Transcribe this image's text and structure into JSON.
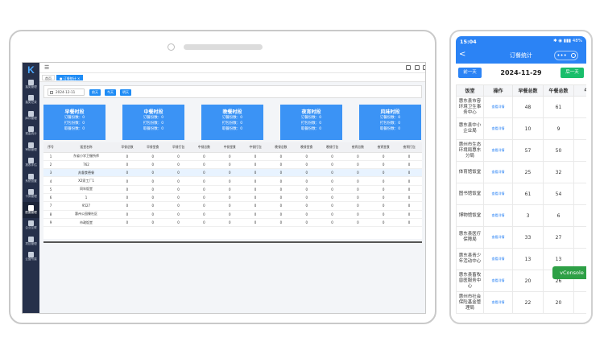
{
  "desktop": {
    "sidebar": {
      "logo": "K",
      "items": [
        {
          "label": "抽奖管理",
          "active": false
        },
        {
          "label": "抽奖记录",
          "active": false
        },
        {
          "label": "库存管理",
          "active": false
        },
        {
          "label": "现金统计",
          "active": false
        },
        {
          "label": "审核管理",
          "active": false
        },
        {
          "label": "报表评估",
          "active": false
        },
        {
          "label": "系统设置",
          "active": false
        },
        {
          "label": "卡券管理",
          "active": false
        },
        {
          "label": "配置管理",
          "active": true
        },
        {
          "label": "企业互联",
          "active": false
        },
        {
          "label": "项目管理",
          "active": false
        },
        {
          "label": "云盘所属",
          "active": false
        }
      ]
    },
    "topbar": {
      "fold_icon": "menu-fold-icon"
    },
    "tags": [
      {
        "label": "首页",
        "active": false
      },
      {
        "label": "● 订餐统计 ×",
        "active": true
      }
    ],
    "filter": {
      "date_value": "2024-12-11",
      "buttons": [
        "前天",
        "今天",
        "明天"
      ]
    },
    "cards": [
      {
        "title": "早餐时段",
        "lines": [
          "订餐份数：0",
          "打包份数：0",
          "取餐份数：0"
        ]
      },
      {
        "title": "中餐时段",
        "lines": [
          "订餐份数：0",
          "打包份数：0",
          "取餐份数：0"
        ]
      },
      {
        "title": "晚餐时段",
        "lines": [
          "订餐份数：0",
          "打包份数：0",
          "取餐份数：0"
        ]
      },
      {
        "title": "夜宵时段",
        "lines": [
          "订餐份数：0",
          "打包份数：0",
          "取餐份数：0"
        ]
      },
      {
        "title": "风味时段",
        "lines": [
          "订餐份数：0",
          "打包份数：0",
          "取餐份数：0"
        ]
      }
    ],
    "table": {
      "headers": [
        "序号",
        "饭堂名称",
        "早餐总数",
        "早餐堂食",
        "早餐打包",
        "中餐总数",
        "中餐堂食",
        "中餐打包",
        "晚餐总数",
        "晚餐堂食",
        "晚餐打包",
        "夜宵总数",
        "夜宵堂食",
        "夜宵打包"
      ],
      "rows": [
        [
          "1",
          "东省小学卫服所师",
          "0",
          "0",
          "0",
          "0",
          "0",
          "0",
          "0",
          "0",
          "0",
          "0",
          "0",
          "0"
        ],
        [
          "2",
          "762",
          "0",
          "0",
          "0",
          "0",
          "0",
          "0",
          "0",
          "0",
          "0",
          "0",
          "0",
          "0"
        ],
        [
          "3",
          "苏督食德餐",
          "0",
          "0",
          "0",
          "0",
          "0",
          "0",
          "0",
          "0",
          "0",
          "0",
          "0",
          "0"
        ],
        [
          "4",
          "X2家工厂1",
          "0",
          "0",
          "0",
          "0",
          "0",
          "0",
          "0",
          "0",
          "0",
          "0",
          "0",
          "0"
        ],
        [
          "5",
          "同年饭堂",
          "0",
          "0",
          "0",
          "0",
          "0",
          "0",
          "0",
          "0",
          "0",
          "0",
          "0",
          "0"
        ],
        [
          "6",
          "1",
          "0",
          "0",
          "0",
          "0",
          "0",
          "0",
          "0",
          "0",
          "0",
          "0",
          "0",
          "0"
        ],
        [
          "7",
          "9527",
          "0",
          "0",
          "0",
          "0",
          "0",
          "0",
          "0",
          "0",
          "0",
          "0",
          "0",
          "0"
        ],
        [
          "8",
          "惠州公园餐社区",
          "0",
          "0",
          "0",
          "0",
          "0",
          "0",
          "0",
          "0",
          "0",
          "0",
          "0",
          "0"
        ],
        [
          "9",
          "市政饭堂",
          "0",
          "0",
          "0",
          "0",
          "0",
          "0",
          "0",
          "0",
          "0",
          "0",
          "0",
          "0"
        ]
      ]
    }
  },
  "phone": {
    "status": {
      "time": "15:04",
      "icons": "✱ ◉ ▮▮▮ 48%"
    },
    "nav": {
      "title": "订餐统计",
      "back": "<",
      "dots": "•••"
    },
    "date": "2024-11-29",
    "prev_label": "前一天",
    "next_label": "后一天",
    "headers": [
      "饭堂",
      "操作",
      "早餐总数",
      "午餐总数",
      "午餐"
    ],
    "op_label": "查看详情",
    "rows": [
      {
        "name": "惠东县市容环境卫生事务中心",
        "vals": [
          "48",
          "61",
          "6"
        ]
      },
      {
        "name": "惠东县中小企业局",
        "vals": [
          "10",
          "9",
          "9"
        ]
      },
      {
        "name": "惠州市生态环境局惠东分局",
        "vals": [
          "57",
          "50",
          "5"
        ]
      },
      {
        "name": "体育馆饭堂",
        "vals": [
          "25",
          "32",
          "3"
        ]
      },
      {
        "name": "图书馆饭堂",
        "vals": [
          "61",
          "54",
          "5"
        ]
      },
      {
        "name": "博物馆饭堂",
        "vals": [
          "3",
          "6",
          "6"
        ]
      },
      {
        "name": "惠东县医疗保障局",
        "vals": [
          "33",
          "27",
          "2"
        ]
      },
      {
        "name": "惠东县青少年活动中心",
        "vals": [
          "13",
          "13",
          "1"
        ]
      },
      {
        "name": "惠东县畜牧兽医服务中心",
        "vals": [
          "20",
          "26",
          "2"
        ]
      },
      {
        "name": "惠州市社会保险基金管理局",
        "vals": [
          "22",
          "20",
          "2"
        ]
      }
    ],
    "vconsole": "vConsole"
  },
  "colors": {
    "primary": "#1f8cf5",
    "card": "#3b93f5",
    "sidebar": "#26304a",
    "green": "#19be6b"
  }
}
